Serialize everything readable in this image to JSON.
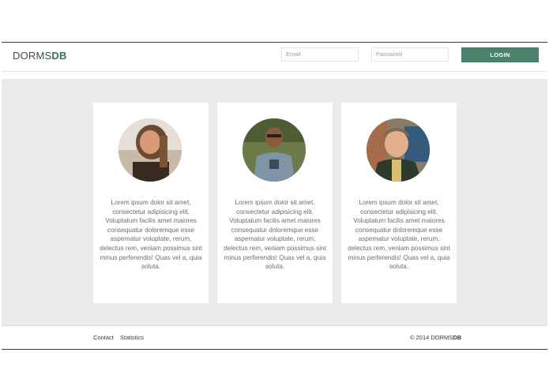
{
  "header": {
    "brand_light": "DORMS",
    "brand_bold": "DB",
    "email_placeholder": "Email",
    "password_placeholder": "Password",
    "login_label": "LOGIN"
  },
  "cards": [
    {
      "text": "Lorem ipsum dolor sit amet, consectetur adipisicing elit. Voluptatum facilis amet maiores consequatur doloremque esse aspernatur voluptate, rerum, delectus rem, veniam possimus sint minus perferendis! Quas vel a, quia soluta."
    },
    {
      "text": "Lorem ipsum dolor sit amet, consectetur adipisicing elit. Voluptatum facilis amet maiores consequatur doloremque esse aspernatur voluptate, rerum, delectus rem, veniam possimus sint minus perferendis! Quas vel a, quia soluta."
    },
    {
      "text": "Lorem ipsum dolor sit amet, consectetur adipisicing elit. Voluptatum facilis amet maiores consequatur doloremque esse aspernatur voluptate, rerum, delectus rem, veniam possimus sint minus perferendis! Quas vel a, quia soluta."
    }
  ],
  "footer": {
    "contact": "Contact",
    "statistics": "Statistics",
    "copyright_prefix": "© 2014 DORMS",
    "copyright_bold": "DB"
  },
  "colors": {
    "accent": "#4b826b",
    "page_bg": "#ebebeb"
  }
}
